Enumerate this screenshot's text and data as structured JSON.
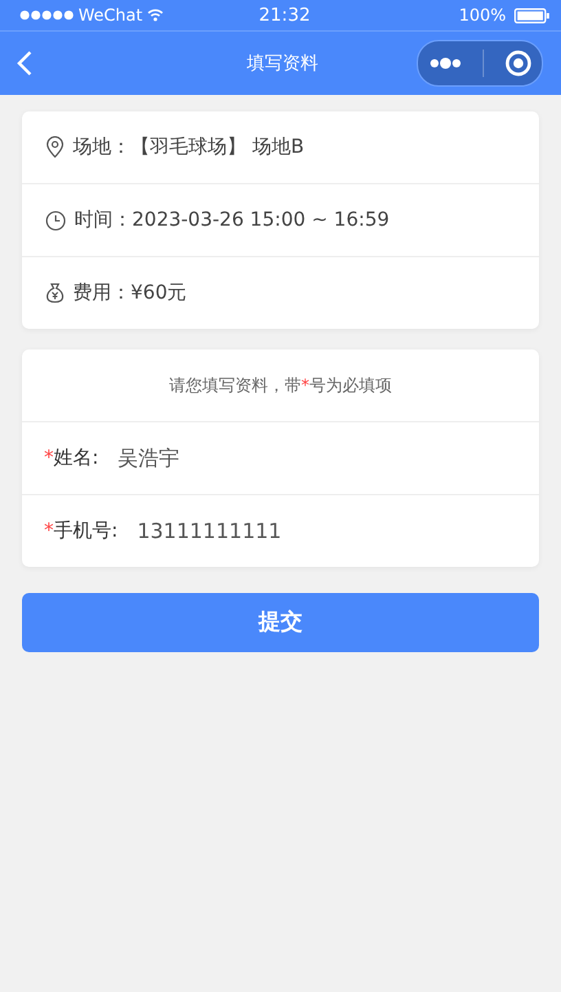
{
  "status_bar": {
    "carrier": "WeChat",
    "time": "21:32",
    "battery": "100%"
  },
  "nav": {
    "title": "填写资料"
  },
  "info": [
    {
      "kind": "location",
      "label": "场地：",
      "value": "【羽毛球场】 场地B"
    },
    {
      "kind": "time",
      "label": "时间：",
      "value": "2023-03-26 15:00 ~ 16:59"
    },
    {
      "kind": "money",
      "label": "费用：",
      "value": "¥60元"
    }
  ],
  "notice": [
    "请您填写资料，带",
    "*",
    "号为必填项"
  ],
  "fields": [
    {
      "mark": "*",
      "label": "姓名:",
      "value": "吴浩宇"
    },
    {
      "mark": "*",
      "label": "手机号:",
      "value": "13111111111"
    }
  ],
  "submit": "提交"
}
